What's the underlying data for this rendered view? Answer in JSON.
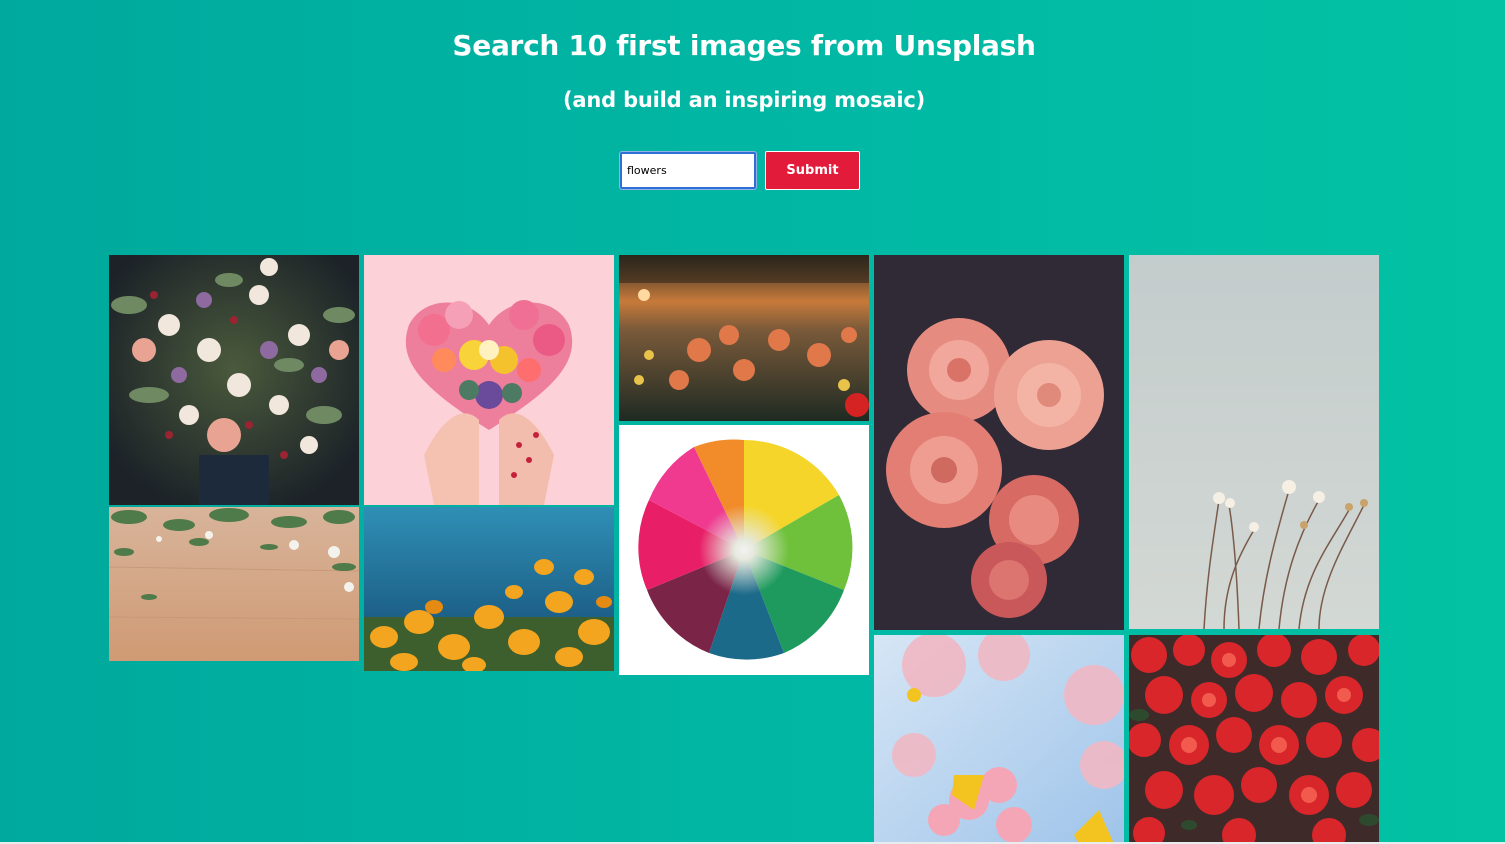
{
  "header": {
    "title": "Search 10 first images from Unsplash",
    "subtitle": "(and build an inspiring mosaic)"
  },
  "search": {
    "value": "flowers",
    "submit_label": "Submit"
  },
  "colors": {
    "background_start": "#00a99d",
    "background_end": "#02c2a3",
    "submit_button": "#e31b3b",
    "input_focus_border": "#2f6fd6"
  },
  "mosaic": {
    "images": [
      {
        "name": "bouquet-photo"
      },
      {
        "name": "heart-flowers-hands-photo"
      },
      {
        "name": "sunset-dahlias-photo"
      },
      {
        "name": "pink-roses-dark-photo"
      },
      {
        "name": "white-wildflowers-photo"
      },
      {
        "name": "greenery-wood-flatlay-photo"
      },
      {
        "name": "orange-poppies-photo"
      },
      {
        "name": "rainbow-chrysanthemum-photo"
      },
      {
        "name": "cherry-blossom-photo"
      },
      {
        "name": "red-begonias-photo"
      }
    ]
  }
}
